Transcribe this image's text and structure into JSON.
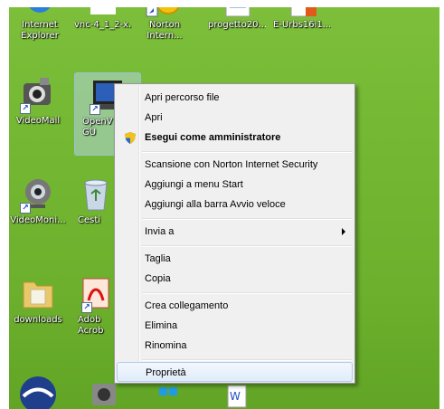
{
  "desktop": {
    "top_icons": [
      "Internet Explorer",
      "vnc-4_1_2-x...",
      "Norton Intern...",
      "progetto20...",
      "E-Urbs16i1..."
    ],
    "left_icons": [
      {
        "label": "VideoMail",
        "icon": "video-camera-icon"
      },
      {
        "label": "OpenV GU",
        "icon": "window-program-icon"
      },
      {
        "label": "VideoMoni...",
        "icon": "webcam-icon"
      },
      {
        "label": "Cesti",
        "icon": "recycle-bin-icon"
      },
      {
        "label": "downloads",
        "icon": "folder-icon"
      },
      {
        "label": "Adob Acrob",
        "icon": "acrobat-icon"
      }
    ]
  },
  "context_menu": {
    "items": [
      {
        "label": "Apri percorso file"
      },
      {
        "label": "Apri"
      },
      {
        "label": "Esegui come amministratore",
        "bold": true,
        "icon": "uac-shield-icon"
      },
      {
        "label": "Scansione con Norton Internet Security"
      },
      {
        "label": "Aggiungi a menu Start"
      },
      {
        "label": "Aggiungi alla barra Avvio veloce"
      },
      {
        "label": "Invia a",
        "submenu": true
      },
      {
        "label": "Taglia"
      },
      {
        "label": "Copia"
      },
      {
        "label": "Crea collegamento"
      },
      {
        "label": "Elimina"
      },
      {
        "label": "Rinomina"
      },
      {
        "label": "Proprietà",
        "highlighted": true
      }
    ]
  },
  "colors": {
    "desktop": "#74b833",
    "menu_bg": "#f0f0f0",
    "highlight_border": "#aeccee"
  }
}
